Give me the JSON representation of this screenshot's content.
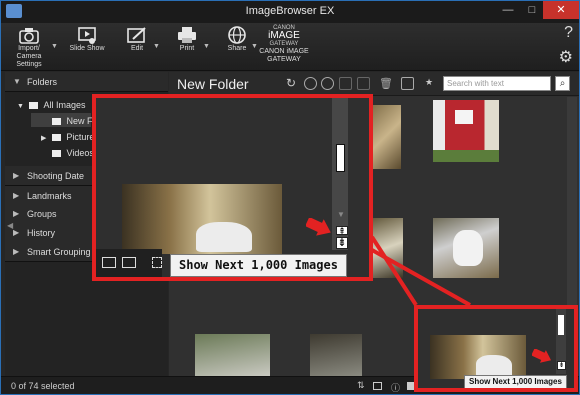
{
  "window": {
    "title": "ImageBrowser EX",
    "controls": {
      "minimize": "—",
      "maximize": "□",
      "close": "✕"
    }
  },
  "toolbar": {
    "items": [
      {
        "label_line1": "Import/",
        "label_line2": "Camera Settings",
        "icon": "camera-icon"
      },
      {
        "label_line1": "Slide Show",
        "label_line2": "",
        "icon": "slideshow-icon"
      },
      {
        "label_line1": "Edit",
        "label_line2": "",
        "icon": "edit-icon"
      },
      {
        "label_line1": "Print",
        "label_line2": "",
        "icon": "printer-icon"
      },
      {
        "label_line1": "Share",
        "label_line2": "",
        "icon": "globe-icon"
      },
      {
        "label_line1": "CANON iMAGE",
        "label_line2": "GATEWAY",
        "icon": "canon-image-gateway-logo"
      }
    ],
    "gateway_logo": {
      "line1": "CANON",
      "line2": "iMAGE",
      "line3": "GATEWAY"
    },
    "help": "?",
    "settings_icon": "gear-icon"
  },
  "sidebar": {
    "folders_header": "Folders",
    "tree": {
      "root": "All Images",
      "selected": "New Folder",
      "child2": "Pictures",
      "child3": "Videos"
    },
    "sections": [
      "Shooting Date",
      "Landmarks",
      "Groups",
      "History",
      "Smart Grouping"
    ]
  },
  "main": {
    "folder_title": "New Folder",
    "search_placeholder": "Search with text",
    "search_icon": "magnifier-icon"
  },
  "tooltip": {
    "text": "Show Next 1,000 Images"
  },
  "status": {
    "selection": "0 of 74 selected"
  },
  "colors": {
    "callout_red": "#e32222",
    "close_button": "#c7322b",
    "window_border": "#2a6fb6"
  }
}
